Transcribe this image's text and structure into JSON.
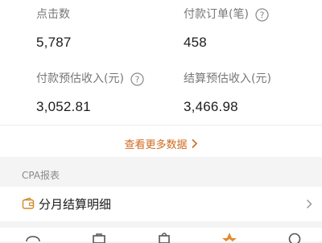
{
  "stats": [
    {
      "label": "点击数",
      "value": "5,787",
      "help": false
    },
    {
      "label": "付款订单(笔)",
      "value": "458",
      "help": true
    },
    {
      "label": "付款预估收入(元)",
      "value": "3,052.81",
      "help": true
    },
    {
      "label": "结算预估收入(元)",
      "value": "3,466.98",
      "help": false
    }
  ],
  "more_link": {
    "label": "查看更多数据",
    "icon": "chevron-right-icon"
  },
  "section": {
    "title": "CPA报表"
  },
  "detail": {
    "label": "分月结算明细",
    "icon": "wallet-icon"
  },
  "tabbar": {
    "icons": [
      "message-icon",
      "bag-icon",
      "shopping-bag-icon",
      "star-icon",
      "search-icon"
    ]
  },
  "colors": {
    "accent": "#d0691d",
    "label": "#777777",
    "value": "#1c1c1c",
    "background": "#f4f4f4"
  }
}
